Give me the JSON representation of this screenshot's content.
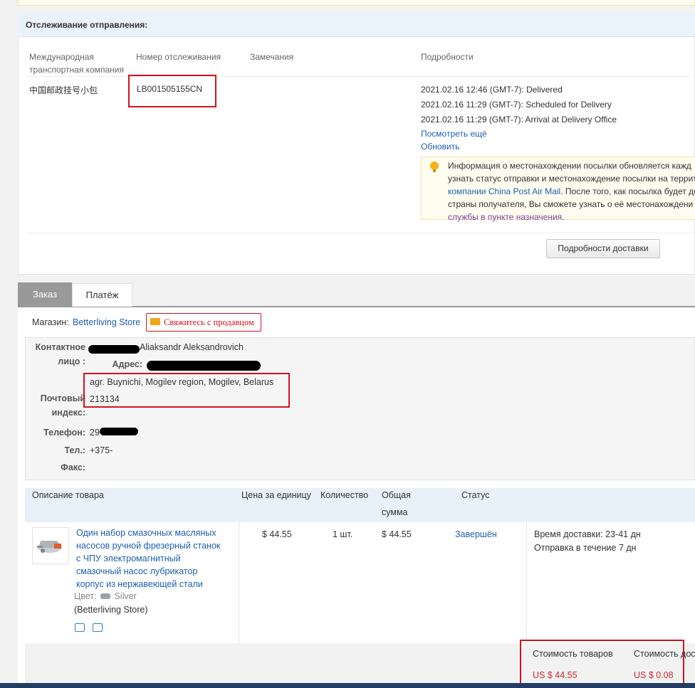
{
  "tracking": {
    "title": "Отслеживание отправления:",
    "columns": {
      "carrier": "Международная транспортная компания",
      "carrier_line1": "Международная",
      "carrier_line2": "транспортная компания",
      "tracking_no": "Номер отслеживания",
      "remarks": "Замечания",
      "details": "Подробности"
    },
    "carrier": "中国邮政挂号小包",
    "tracking_number": "LB001505155CN",
    "events": [
      "2021.02.16 12:46 (GMT-7): Delivered",
      "2021.02.16 11:29 (GMT-7): Scheduled for Delivery",
      "2021.02.16 11:29 (GMT-7): Arrival at Delivery Office"
    ],
    "see_more": "Посмотреть ещё",
    "refresh": "Обновить",
    "info": {
      "line1": "Информация о местонахождении посылки обновляется кажд",
      "line2": "узнать статус отправки и местонахождение посылки на террит",
      "line3_link": "компании China Post Air Mail",
      "line3_rest": ". После того, как посылка будет до",
      "line4": "страны получателя, Вы сможете узнать о её местонахождени",
      "line5_link": "службы в пункте назначения",
      "line5_rest": "."
    },
    "details_button": "Подробности доставки"
  },
  "tabs": [
    {
      "label": "Заказ",
      "active": true
    },
    {
      "label": "Платёж",
      "active": false
    }
  ],
  "store": {
    "label": "Магазин:",
    "name": "Betterliving Store",
    "contact_button": "Свяжитесь с продавцом"
  },
  "contact": {
    "person_label_1": "Контактное",
    "person_label_2": "лицо :",
    "person_value": "Aliaksandr Aleksandrovich",
    "address_label": "Адрес:",
    "address_value": "agr. Buynichi, Mogilev region, Mogilev, Belarus",
    "postal_label_1": "Почтовый",
    "postal_label_2": "индекс:",
    "postal_value": "213134",
    "phone_label": "Телефон:",
    "phone_value": "29",
    "tel_label": "Тел.:",
    "tel_value": "+375-",
    "fax_label": "Факс:",
    "fax_value": ""
  },
  "items_table": {
    "headers": {
      "description": "Описание товара",
      "unit_price": "Цена за единицу",
      "quantity": "Количество",
      "total_1": "Общая",
      "total_2": "сумма",
      "status": "Статус"
    },
    "item": {
      "title_lines": [
        "Один набор смазочных масляных",
        "насосов ручной фрезерный станок",
        "с ЧПУ электромагнитный",
        "смазочный насос лубрикатор",
        "корпус из нержавеющей стали"
      ],
      "color_label": "Цвет:",
      "color_value": "Silver",
      "store": "(Betterliving Store)",
      "unit_price": "$ 44.55",
      "quantity": "1 шт.",
      "total": "$ 44.55",
      "status": "Завершён",
      "delivery_time": "Время доставки: 23-41 дн",
      "dispatch": "Отправка в течение 7 дн"
    }
  },
  "summary": {
    "goods_label": "Стоимость товаров",
    "goods_value": "US $ 44.55",
    "shipping_label": "Стоимость дос",
    "shipping_value": "US $ 0.08"
  },
  "colors": {
    "accent_link": "#1f5fb0",
    "highlight_red": "#d4121e",
    "price_red": "#d0282e",
    "header_blue": "#eaf2fb"
  }
}
